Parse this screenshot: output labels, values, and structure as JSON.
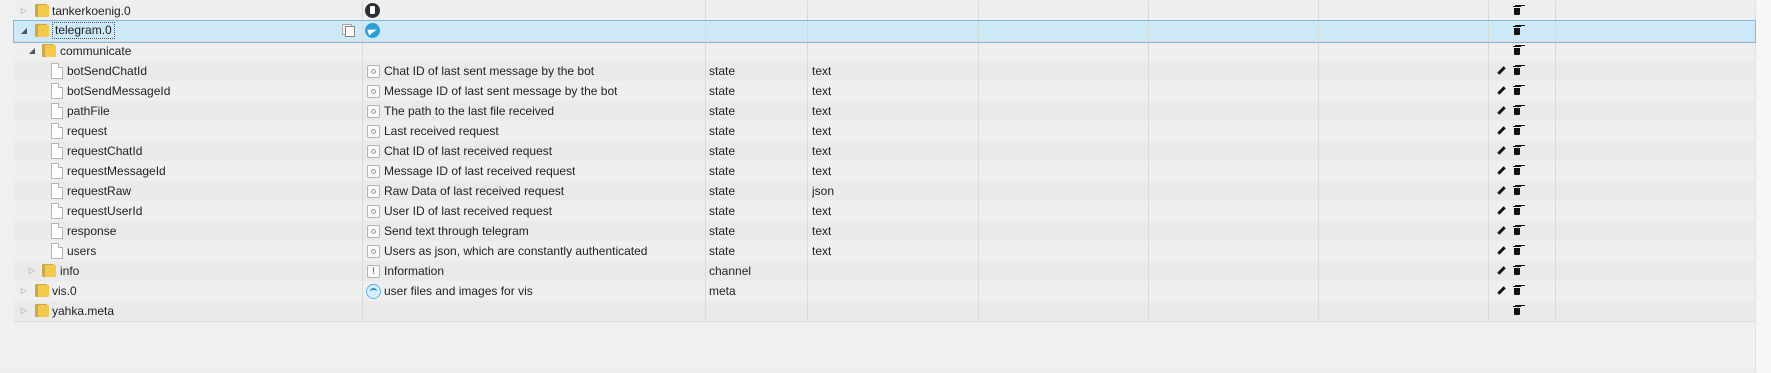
{
  "rows": [
    {
      "name": "tankerkoenig.0",
      "kind": "folder",
      "level": 0,
      "expander": "collapsed",
      "icon": "tankerkoenig-icon",
      "desc": "",
      "role": "",
      "type": ""
    },
    {
      "name": "telegram.0",
      "kind": "folder",
      "level": 0,
      "expander": "expanded",
      "icon": "telegram-icon",
      "desc": "",
      "role": "",
      "type": "",
      "selected": true
    },
    {
      "name": "communicate",
      "kind": "folder",
      "level": 1,
      "expander": "expanded",
      "icon": "",
      "desc": "",
      "role": "",
      "type": ""
    },
    {
      "name": "botSendChatId",
      "kind": "state",
      "level": 2,
      "desc": "Chat ID of last sent message by the bot",
      "role": "state",
      "type": "text"
    },
    {
      "name": "botSendMessageId",
      "kind": "state",
      "level": 2,
      "desc": "Message ID of last sent message by the bot",
      "role": "state",
      "type": "text"
    },
    {
      "name": "pathFile",
      "kind": "state",
      "level": 2,
      "desc": "The path to the last file received",
      "role": "state",
      "type": "text"
    },
    {
      "name": "request",
      "kind": "state",
      "level": 2,
      "desc": "Last received request",
      "role": "state",
      "type": "text"
    },
    {
      "name": "requestChatId",
      "kind": "state",
      "level": 2,
      "desc": "Chat ID of last received request",
      "role": "state",
      "type": "text"
    },
    {
      "name": "requestMessageId",
      "kind": "state",
      "level": 2,
      "desc": "Message ID of last received request",
      "role": "state",
      "type": "text"
    },
    {
      "name": "requestRaw",
      "kind": "state",
      "level": 2,
      "desc": "Raw Data of last received request",
      "role": "state",
      "type": "json"
    },
    {
      "name": "requestUserId",
      "kind": "state",
      "level": 2,
      "desc": "User ID of last received request",
      "role": "state",
      "type": "text"
    },
    {
      "name": "response",
      "kind": "state",
      "level": 2,
      "desc": "Send text through telegram",
      "role": "state",
      "type": "text"
    },
    {
      "name": "users",
      "kind": "state",
      "level": 2,
      "desc": "Users as json, which are constantly authenticated",
      "role": "state",
      "type": "text"
    },
    {
      "name": "info",
      "kind": "folder",
      "level": 1,
      "expander": "collapsed",
      "icon": "info-icon",
      "desc": "Information",
      "role": "channel",
      "type": ""
    },
    {
      "name": "vis.0",
      "kind": "folder",
      "level": 0,
      "expander": "collapsed",
      "icon": "vis-icon",
      "desc": "user files and images for vis",
      "role": "meta",
      "type": ""
    },
    {
      "name": "yahka.meta",
      "kind": "folder",
      "level": 0,
      "expander": "collapsed",
      "icon": "",
      "desc": "",
      "role": "",
      "type": ""
    }
  ]
}
